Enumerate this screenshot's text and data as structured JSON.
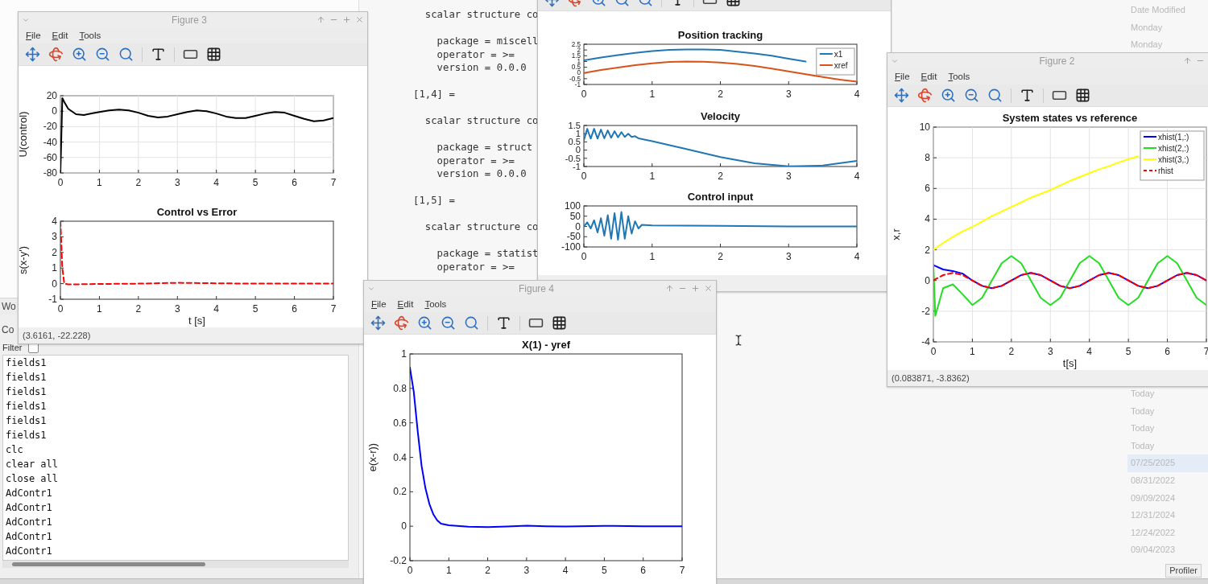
{
  "command_window": {
    "lines": [
      {
        "kind": "scalar",
        "text": "scalar structure co"
      },
      {
        "kind": "field",
        "text": "package = miscell"
      },
      {
        "kind": "field",
        "text": "operator = >="
      },
      {
        "kind": "field",
        "text": "version = 0.0.0"
      },
      {
        "kind": "index",
        "text": "[1,4] ="
      },
      {
        "kind": "scalar",
        "text": "scalar structure co"
      },
      {
        "kind": "field",
        "text": "package = struct"
      },
      {
        "kind": "field",
        "text": "operator = >="
      },
      {
        "kind": "field",
        "text": "version = 0.0.0"
      },
      {
        "kind": "index",
        "text": "[1,5] ="
      },
      {
        "kind": "scalar",
        "text": "scalar structure co"
      },
      {
        "kind": "field",
        "text": "package = statist"
      },
      {
        "kind": "field",
        "text": "operator = >="
      }
    ]
  },
  "workspace_tab": "Wo",
  "command_history": {
    "title": "Co",
    "filter_label": "Filter",
    "filter_checked": false,
    "entries": [
      "fields1",
      "fields1",
      "fields1",
      "fields1",
      "fields1",
      "fields1",
      "clc",
      "clear all",
      "close all",
      "AdContr1",
      "AdContr1",
      "AdContr1",
      "AdContr1",
      "AdContr1"
    ]
  },
  "file_dates": {
    "header": "Date Modified",
    "top_rows": [
      {
        "text": "Monday",
        "selected": false
      },
      {
        "text": "Monday",
        "selected": false
      }
    ],
    "rows": [
      {
        "text": "Today",
        "selected": false
      },
      {
        "text": "Today",
        "selected": false
      },
      {
        "text": "Today",
        "selected": false
      },
      {
        "text": "Today",
        "selected": false
      },
      {
        "text": "07/25/2025",
        "selected": true
      },
      {
        "text": "08/31/2022",
        "selected": false
      },
      {
        "text": "09/09/2024",
        "selected": false
      },
      {
        "text": "12/31/2024",
        "selected": false
      },
      {
        "text": "12/24/2022",
        "selected": false
      },
      {
        "text": "09/04/2023",
        "selected": false
      }
    ]
  },
  "profiler_button": "Profiler",
  "figures": [
    {
      "title": "Figure 3",
      "menus": [
        "File",
        "Edit",
        "Tools"
      ],
      "status": "(3.6161, -22.228)",
      "charts": [
        {
          "chart_data": {
            "type": "line",
            "ylabel": "U(control)",
            "grid": true,
            "x": [
              0,
              0.02,
              0.05,
              0.1,
              0.2,
              0.4,
              0.6,
              0.8,
              1,
              1.25,
              1.5,
              1.75,
              2,
              2.25,
              2.5,
              2.75,
              3,
              3.25,
              3.5,
              3.75,
              4,
              4.25,
              4.5,
              4.75,
              5,
              5.25,
              5.5,
              5.75,
              6,
              6.25,
              6.5,
              6.75,
              7
            ],
            "series": [
              {
                "color": "#000000",
                "line_style": "solid",
                "values": [
                  -80,
                  -40,
                  17,
                  12,
                  3,
                  -4,
                  -5,
                  -3,
                  -1,
                  1,
                  2,
                  1,
                  -2,
                  -6,
                  -8,
                  -7,
                  -4,
                  -1,
                  1,
                  0,
                  -3,
                  -7,
                  -9,
                  -9,
                  -6,
                  -3,
                  -1,
                  -2,
                  -6,
                  -10,
                  -13,
                  -12,
                  -9
                ]
              }
            ],
            "xlim": [
              0,
              7
            ],
            "ylim": [
              -80,
              20
            ],
            "xticks": [
              0,
              1,
              2,
              3,
              4,
              5,
              6,
              7
            ],
            "yticks": [
              -80,
              -60,
              -40,
              -20,
              0,
              20
            ]
          }
        },
        {
          "chart_data": {
            "type": "line",
            "title": "Control vs Error",
            "xlabel": "t [s]",
            "ylabel": "s(x-y')",
            "grid": false,
            "x": [
              0,
              0.05,
              0.1,
              0.2,
              1,
              2,
              3,
              4,
              5,
              6,
              7
            ],
            "series": [
              {
                "color": "#ff0000",
                "line_style": "dashed",
                "values": [
                  4,
                  1,
                  0,
                  -0.05,
                  -0.02,
                  0,
                  0.05,
                  0.02,
                  0,
                  0,
                  0
                ]
              }
            ],
            "xlim": [
              0,
              7
            ],
            "ylim": [
              -1,
              4
            ],
            "xticks": [
              0,
              1,
              2,
              3,
              4,
              5,
              6,
              7
            ],
            "yticks": [
              -1,
              0,
              1,
              2,
              3,
              4
            ]
          }
        }
      ]
    },
    {
      "charts": [
        {
          "chart_data": {
            "type": "line",
            "title": "Position tracking",
            "grid": false,
            "legend": true,
            "x": [
              0,
              0.25,
              0.5,
              0.75,
              1,
              1.25,
              1.5,
              1.75,
              2,
              2.25,
              2.5,
              2.75,
              3,
              3.25,
              3.5,
              3.75,
              4
            ],
            "series": [
              {
                "name": "x1",
                "color": "#1f77b4",
                "line_style": "solid",
                "values": [
                  1.1,
                  1.35,
                  1.55,
                  1.75,
                  1.9,
                  2,
                  2.05,
                  2.05,
                  2,
                  1.85,
                  1.7,
                  1.5,
                  1.25,
                  1,
                  null,
                  null,
                  null
                ]
              },
              {
                "name": "xref",
                "color": "#d95319",
                "line_style": "solid",
                "values": [
                  0,
                  0.25,
                  0.48,
                  0.68,
                  0.84,
                  0.95,
                  1,
                  0.98,
                  0.91,
                  0.78,
                  0.6,
                  0.38,
                  0.14,
                  -0.11,
                  -0.35,
                  -0.57,
                  -0.76
                ]
              }
            ],
            "xlim": [
              0,
              4
            ],
            "ylim": [
              -1,
              2.5
            ],
            "xticks": [
              0,
              1,
              2,
              3,
              4
            ],
            "yticks": [
              -1,
              -0.5,
              0,
              0.5,
              1,
              1.5,
              2,
              2.5
            ]
          }
        },
        {
          "chart_data": {
            "type": "line",
            "title": "Velocity",
            "grid": false,
            "x": [
              0,
              0.05,
              0.1,
              0.15,
              0.2,
              0.25,
              0.3,
              0.35,
              0.4,
              0.45,
              0.5,
              0.55,
              0.6,
              0.65,
              0.7,
              0.75,
              0.8,
              1,
              1.5,
              2,
              2.5,
              3,
              3.5,
              4
            ],
            "series": [
              {
                "color": "#1f77b4",
                "line_style": "solid",
                "values": [
                  0.6,
                  1.3,
                  0.7,
                  1.3,
                  0.7,
                  1.25,
                  0.72,
                  1.2,
                  0.75,
                  1.15,
                  0.78,
                  1.1,
                  0.8,
                  1,
                  0.8,
                  0.85,
                  0.72,
                  0.54,
                  0.07,
                  -0.42,
                  -0.8,
                  -0.99,
                  -0.94,
                  -0.65
                ]
              }
            ],
            "xlim": [
              0,
              4
            ],
            "ylim": [
              -1,
              1.5
            ],
            "xticks": [
              0,
              1,
              2,
              3,
              4
            ],
            "yticks": [
              -1,
              -0.5,
              0,
              0.5,
              1,
              1.5
            ]
          }
        },
        {
          "chart_data": {
            "type": "line",
            "title": "Control input",
            "grid": false,
            "x": [
              0,
              0.05,
              0.1,
              0.15,
              0.2,
              0.25,
              0.3,
              0.35,
              0.4,
              0.45,
              0.5,
              0.55,
              0.6,
              0.65,
              0.7,
              0.75,
              0.8,
              0.85,
              1,
              2,
              3,
              4
            ],
            "series": [
              {
                "color": "#1f77b4",
                "line_style": "solid",
                "values": [
                  0,
                  20,
                  -10,
                  30,
                  -30,
                  40,
                  -45,
                  55,
                  -60,
                  65,
                  -65,
                  70,
                  -60,
                  50,
                  -35,
                  25,
                  -10,
                  8,
                  5,
                  3,
                  0,
                  0
                ]
              }
            ],
            "xlim": [
              0,
              4
            ],
            "ylim": [
              -100,
              100
            ],
            "xticks": [
              0,
              1,
              2,
              3,
              4
            ],
            "yticks": [
              -100,
              -50,
              0,
              50,
              100
            ]
          }
        }
      ]
    },
    {
      "title": "Figure 2",
      "menus": [
        "File",
        "Edit",
        "Tools"
      ],
      "status": "(0.083871, -3.8362)",
      "charts": [
        {
          "chart_data": {
            "type": "line",
            "title": "System states vs reference",
            "xlabel": "t[s]",
            "ylabel": "x,r",
            "grid": true,
            "legend": true,
            "x": [
              0,
              0.05,
              0.25,
              0.5,
              0.75,
              1,
              1.25,
              1.5,
              1.75,
              2,
              2.25,
              2.5,
              2.75,
              3,
              3.25,
              3.5,
              3.75,
              4,
              4.25,
              4.5,
              4.75,
              5,
              5.25,
              5.5,
              5.75,
              6,
              6.25,
              6.5,
              6.75,
              7
            ],
            "series": [
              {
                "name": "xhist(1,:)",
                "color": "#0000ff",
                "line_style": "solid",
                "values": [
                  1,
                  0.95,
                  0.72,
                  0.62,
                  0.45,
                  0,
                  -0.35,
                  -0.5,
                  -0.35,
                  0,
                  0.35,
                  0.5,
                  0.35,
                  0,
                  -0.35,
                  -0.5,
                  -0.35,
                  0,
                  0.35,
                  0.5,
                  0.35,
                  0,
                  -0.35,
                  -0.5,
                  -0.35,
                  0,
                  0.35,
                  0.5,
                  0.35,
                  0
                ]
              },
              {
                "name": "xhist(2,:)",
                "color": "#22dd22",
                "line_style": "solid",
                "values": [
                  1,
                  -2.3,
                  -0.5,
                  -0.25,
                  -0.9,
                  -1.6,
                  -1.13,
                  0,
                  1.13,
                  1.6,
                  1.13,
                  0,
                  -1.13,
                  -1.6,
                  -1.13,
                  0,
                  1.13,
                  1.6,
                  1.13,
                  0,
                  -1.13,
                  -1.6,
                  -1.13,
                  0,
                  1.13,
                  1.6,
                  1.13,
                  0,
                  -1.13,
                  -1.6
                ]
              },
              {
                "name": "xhist(3,:)",
                "color": "#ffff00",
                "line_style": "solid",
                "values": [
                  2,
                  2.1,
                  2.45,
                  2.85,
                  3.2,
                  3.5,
                  3.85,
                  4.2,
                  4.5,
                  4.8,
                  5.1,
                  5.4,
                  5.65,
                  5.9,
                  6.2,
                  6.5,
                  6.75,
                  7,
                  7.25,
                  7.45,
                  7.7,
                  7.9,
                  8.1,
                  null,
                  null,
                  null,
                  null,
                  null,
                  null,
                  null
                ]
              },
              {
                "name": "rhist",
                "color": "#ff0000",
                "line_style": "dashed",
                "values": [
                  0,
                  0.08,
                  0.35,
                  0.5,
                  0.35,
                  0,
                  -0.35,
                  -0.5,
                  -0.35,
                  0,
                  0.35,
                  0.5,
                  0.35,
                  0,
                  -0.35,
                  -0.5,
                  -0.35,
                  0,
                  0.35,
                  0.5,
                  0.35,
                  0,
                  -0.35,
                  -0.5,
                  -0.35,
                  0,
                  0.35,
                  0.5,
                  0.35,
                  0
                ]
              }
            ],
            "xlim": [
              0,
              7
            ],
            "ylim": [
              -4,
              10
            ],
            "xticks": [
              0,
              1,
              2,
              3,
              4,
              5,
              6,
              7
            ],
            "yticks": [
              -4,
              -2,
              0,
              2,
              4,
              6,
              8,
              10
            ]
          }
        }
      ]
    },
    {
      "title": "Figure 4",
      "menus": [
        "File",
        "Edit",
        "Tools"
      ],
      "charts": [
        {
          "chart_data": {
            "type": "line",
            "title": "X(1) - yref",
            "ylabel": "e(x-r))",
            "grid": false,
            "x": [
              0,
              0.1,
              0.2,
              0.3,
              0.4,
              0.5,
              0.6,
              0.7,
              0.8,
              1,
              1.5,
              2,
              2.5,
              3,
              3.5,
              4,
              5,
              6,
              7
            ],
            "series": [
              {
                "color": "#0000ff",
                "line_style": "solid",
                "values": [
                  0.92,
                  0.78,
                  0.55,
                  0.35,
                  0.22,
                  0.13,
                  0.07,
                  0.035,
                  0.015,
                  0.005,
                  -0.003,
                  -0.005,
                  -0.002,
                  0.003,
                  0,
                  -0.002,
                  0.002,
                  0,
                  0
                ]
              }
            ],
            "xlim": [
              0,
              7
            ],
            "ylim": [
              -0.2,
              1
            ],
            "xticks": [
              0,
              1,
              2,
              3,
              4,
              5,
              6,
              7
            ],
            "yticks": [
              -0.2,
              0,
              0.2,
              0.4,
              0.6,
              0.8,
              1
            ]
          }
        }
      ]
    }
  ]
}
